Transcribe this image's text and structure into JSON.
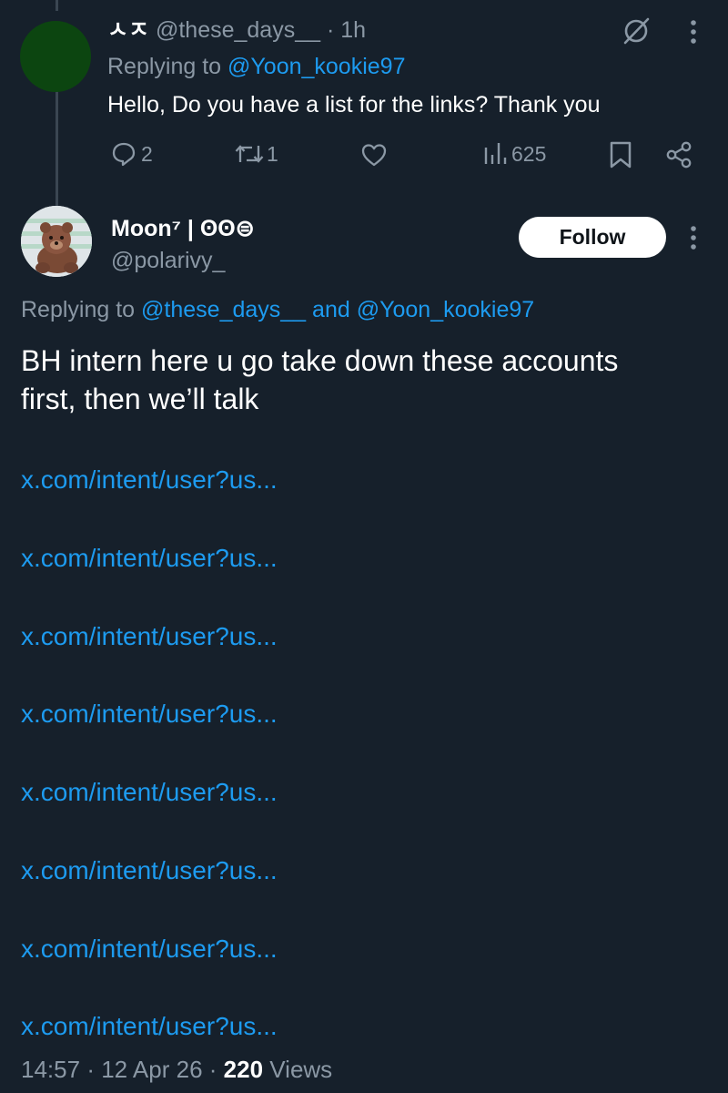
{
  "colors": {
    "background": "#16202b",
    "text": "#ffffff",
    "muted": "#8b98a5",
    "link": "#1d9bf0",
    "thread": "#3a4652"
  },
  "reply": {
    "display_name": "ㅅㅈ",
    "handle": "@these_days__",
    "separator": "·",
    "time": "1h",
    "replying_prefix": "Replying to",
    "replying_to": "@Yoon_kookie97",
    "text": "Hello, Do you have a list for the links? Thank you",
    "actions": {
      "replies": "2",
      "reposts": "1",
      "views": "625"
    }
  },
  "tweet": {
    "display_name": "Moon⁷ | ʘʘ⊜",
    "handle": "@polarivy_",
    "follow_label": "Follow",
    "replying_prefix": "Replying to",
    "replying_handle_1": "@these_days__",
    "replying_and": "and",
    "replying_handle_2": "@Yoon_kookie97",
    "text_line1": "BH intern here u go take down these accounts",
    "text_line2": "first, then we’ll talk",
    "links": [
      "x.com/intent/user?us...",
      "x.com/intent/user?us...",
      "x.com/intent/user?us...",
      "x.com/intent/user?us...",
      "x.com/intent/user?us...",
      "x.com/intent/user?us...",
      "x.com/intent/user?us...",
      "x.com/intent/user?us..."
    ],
    "footer": {
      "time": "14:57",
      "sep1": "·",
      "date": "12 Apr 26",
      "sep2": "·",
      "views": "220",
      "views_label": "Views"
    }
  }
}
